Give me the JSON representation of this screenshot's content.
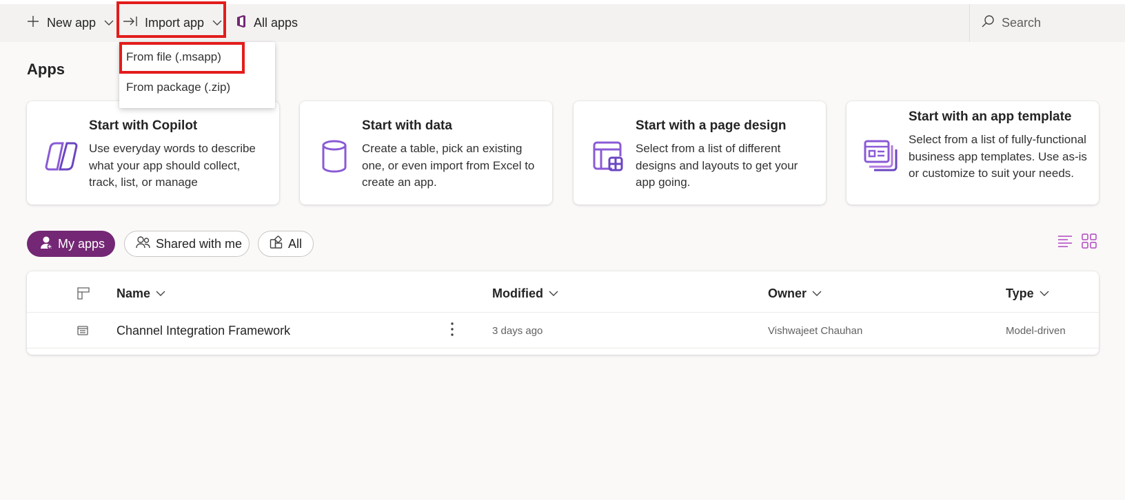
{
  "colors": {
    "accent": "#742774",
    "icon_purple": "#8a5ad6",
    "highlight_red": "#e31c1c",
    "page_bg": "#faf9f8"
  },
  "commandbar": {
    "new_app": {
      "label": "New app",
      "icon": "plus-icon"
    },
    "import_app": {
      "label": "Import app",
      "icon": "import-arrow-icon"
    },
    "all_apps": {
      "label": "All apps",
      "icon": "office-icon"
    },
    "search": {
      "placeholder": "Search",
      "icon": "search-icon"
    }
  },
  "import_menu": {
    "items": [
      {
        "label": "From file (.msapp)"
      },
      {
        "label": "From package (.zip)"
      }
    ]
  },
  "page_title": "Apps",
  "start_cards": [
    {
      "title": "Start with Copilot",
      "description": "Use everyday words to describe what your app should collect, track, list, or manage",
      "icon": "copilot-icon"
    },
    {
      "title": "Start with data",
      "description": "Create a table, pick an existing one, or even import from Excel to create an app.",
      "icon": "database-icon"
    },
    {
      "title": "Start with a page design",
      "description": "Select from a list of different designs and layouts to get your app going.",
      "icon": "page-design-icon"
    },
    {
      "title": "Start with an app template",
      "description": "Select from a list of fully-functional business app templates. Use as-is or customize to suit your needs.",
      "icon": "app-template-icon"
    }
  ],
  "filters": {
    "my_apps": "My apps",
    "shared_with_me": "Shared with me",
    "all": "All",
    "selected": "My apps"
  },
  "view_toggle": {
    "list_icon": "list-view-icon",
    "grid_icon": "grid-view-icon"
  },
  "table": {
    "columns": [
      "Name",
      "Modified",
      "Owner",
      "Type"
    ],
    "rows": [
      {
        "name": "Channel Integration Framework",
        "modified": "3 days ago",
        "owner": "Vishwajeet Chauhan",
        "type": "Model-driven"
      }
    ]
  }
}
